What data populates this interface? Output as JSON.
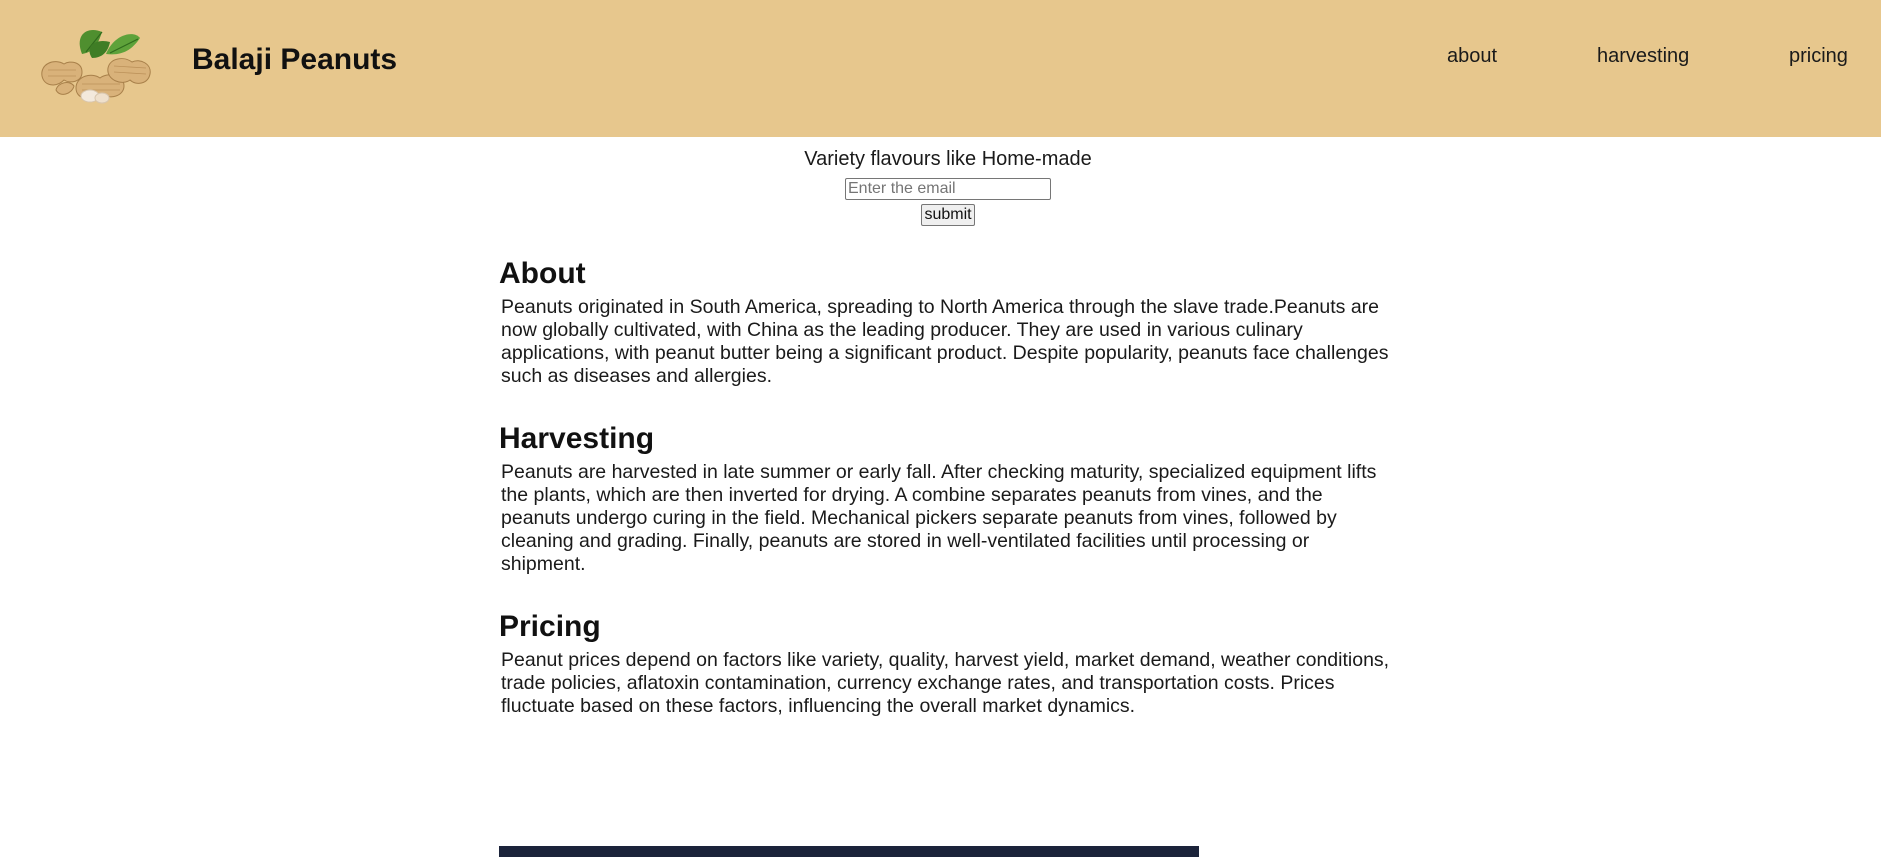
{
  "header": {
    "logo_icon": "peanuts-logo-icon",
    "brand": "Balaji Peanuts",
    "nav": [
      {
        "label": "about"
      },
      {
        "label": "harvesting"
      },
      {
        "label": "pricing"
      }
    ],
    "background_color": "#e7c78d"
  },
  "hero": {
    "tagline": "Variety flavours like Home-made",
    "email_placeholder": "Enter the email",
    "email_value": "",
    "submit_label": "submit"
  },
  "sections": [
    {
      "title": "About",
      "body": "Peanuts originated in South America, spreading to North America through the slave trade.Peanuts are now globally cultivated, with China as the leading producer. They are used in various culinary applications, with peanut butter being a significant product. Despite popularity, peanuts face challenges such as diseases and allergies."
    },
    {
      "title": "Harvesting",
      "body": "Peanuts are harvested in late summer or early fall. After checking maturity, specialized equipment lifts the plants, which are then inverted for drying. A combine separates peanuts from vines, and the peanuts undergo curing in the field. Mechanical pickers separate peanuts from vines, followed by cleaning and grading. Finally, peanuts are stored in well-ventilated facilities until processing or shipment."
    },
    {
      "title": "Pricing",
      "body": "Peanut prices depend on factors like variety, quality, harvest yield, market demand, weather conditions, trade policies, aflatoxin contamination, currency exchange rates, and transportation costs. Prices fluctuate based on these factors, influencing the overall market dynamics."
    }
  ],
  "footer": {
    "bar_color": "#1b233a"
  }
}
